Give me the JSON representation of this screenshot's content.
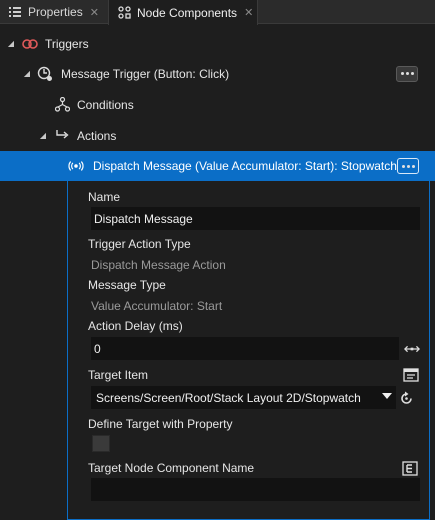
{
  "tabs": [
    {
      "label": "Properties",
      "icon": "list-icon"
    },
    {
      "label": "Node Components",
      "icon": "node-components-icon",
      "active": true
    }
  ],
  "tree": {
    "triggers": {
      "label": "Triggers",
      "icon": "triggers-icon"
    },
    "message_trigger": {
      "label": "Message Trigger (Button: Click)",
      "icon": "message-trigger-icon"
    },
    "conditions": {
      "label": "Conditions",
      "icon": "conditions-icon"
    },
    "actions": {
      "label": "Actions",
      "icon": "actions-icon"
    },
    "dispatch_message": {
      "label": "Dispatch Message (Value Accumulator: Start): Stopwatch",
      "icon": "dispatch-message-icon",
      "selected": true
    }
  },
  "properties": {
    "name_label": "Name",
    "name_value": "Dispatch Message",
    "trigger_action_type_label": "Trigger Action Type",
    "trigger_action_type_value": "Dispatch Message Action",
    "message_type_label": "Message Type",
    "message_type_value": "Value Accumulator: Start",
    "action_delay_label": "Action Delay (ms)",
    "action_delay_value": "0",
    "target_item_label": "Target Item",
    "target_item_value": "Screens/Screen/Root/Stack Layout 2D/Stopwatch",
    "define_target_label": "Define Target with Property",
    "target_node_component_label": "Target Node Component Name",
    "target_node_component_value": ""
  },
  "colors": {
    "selection": "#0b6ec7",
    "background": "#1e1e1e",
    "field": "#121212",
    "trigger_red": "#e05a5a"
  }
}
